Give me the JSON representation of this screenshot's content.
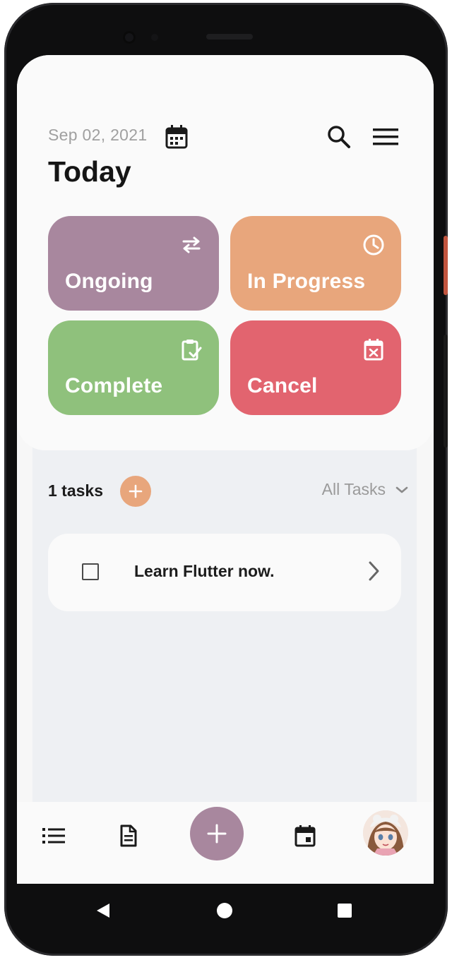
{
  "header": {
    "date": "Sep 02, 2021",
    "title": "Today"
  },
  "status_cards": [
    {
      "label": "Ongoing",
      "icon": "swap-arrows-icon",
      "color": "#a8879e"
    },
    {
      "label": "In Progress",
      "icon": "clock-icon",
      "color": "#e8a67c"
    },
    {
      "label": "Complete",
      "icon": "clipboard-check-icon",
      "color": "#8fc17c"
    },
    {
      "label": "Cancel",
      "icon": "calendar-x-icon",
      "color": "#e2646f"
    }
  ],
  "tasks": {
    "count_label": "1 tasks",
    "filter_label": "All Tasks",
    "items": [
      {
        "title": "Learn Flutter now.",
        "checked": false
      }
    ]
  },
  "bottom_nav": {
    "items": [
      "list-icon",
      "document-icon",
      "add-icon",
      "calendar-icon",
      "avatar"
    ]
  },
  "colors": {
    "accent_purple": "#a8879e",
    "accent_orange": "#e8a67c",
    "accent_green": "#8fc17c",
    "accent_red": "#e2646f"
  }
}
